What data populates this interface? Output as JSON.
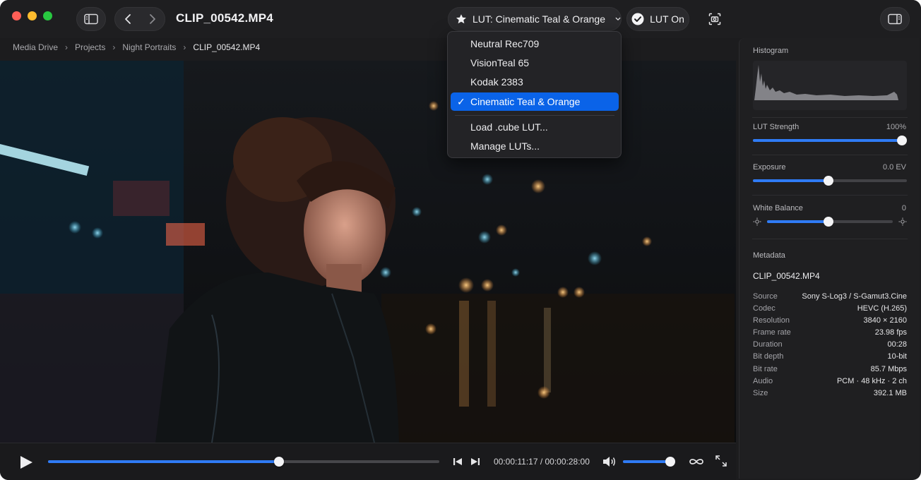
{
  "window": {
    "title": "CLIP_00542.MP4"
  },
  "toolbar": {
    "lut_selector_label": "LUT: Cinematic Teal & Orange",
    "lut_toggle_label": "LUT On"
  },
  "breadcrumb": [
    "Media Drive",
    "Projects",
    "Night Portraits",
    "CLIP_00542.MP4"
  ],
  "lut_menu": {
    "items": [
      {
        "label": "Neutral Rec709",
        "selected": false
      },
      {
        "label": "VisionTeal 65",
        "selected": false
      },
      {
        "label": "Kodak 2383",
        "selected": false
      },
      {
        "label": "Cinematic Teal & Orange",
        "selected": true
      }
    ],
    "actions": [
      "Load .cube LUT...",
      "Manage LUTs..."
    ],
    "check_glyph": "✓"
  },
  "playback": {
    "timecode": "00:00:11:17 / 00:00:28:00",
    "progress_fraction": 0.59,
    "volume_fraction": 0.98
  },
  "inspector": {
    "histogram_label": "Histogram",
    "lut_strength": {
      "label": "LUT Strength",
      "value": "100%",
      "fraction": 0.97
    },
    "exposure": {
      "label": "Exposure",
      "value": "0.0 EV",
      "fraction": 0.49
    },
    "white_balance": {
      "label": "White Balance",
      "value": "0",
      "fraction": 0.49
    },
    "metadata_label": "Metadata",
    "file_name": "CLIP_00542.MP4",
    "metadata": [
      {
        "key": "Source",
        "value": "Sony S-Log3 / S-Gamut3.Cine"
      },
      {
        "key": "Codec",
        "value": "HEVC (H.265)"
      },
      {
        "key": "Resolution",
        "value": "3840 × 2160"
      },
      {
        "key": "Frame rate",
        "value": "23.98 fps"
      },
      {
        "key": "Duration",
        "value": "00:28"
      },
      {
        "key": "Bit depth",
        "value": "10-bit"
      },
      {
        "key": "Bit rate",
        "value": "85.7 Mbps"
      },
      {
        "key": "Audio",
        "value": "PCM · 48 kHz · 2 ch"
      },
      {
        "key": "Size",
        "value": "392.1 MB"
      }
    ]
  },
  "colors": {
    "accent": "#2f7bf5",
    "menu_highlight": "#0a63e8"
  },
  "icons": [
    "sidebar-icon",
    "chevron-left-icon",
    "chevron-right-icon",
    "star-icon",
    "chevron-down-icon",
    "checkmark-circle-icon",
    "snapshot-icon",
    "inspector-icon",
    "play-icon",
    "step-back-icon",
    "step-forward-icon",
    "volume-icon",
    "loop-icon",
    "fullscreen-icon",
    "sun-icon"
  ]
}
